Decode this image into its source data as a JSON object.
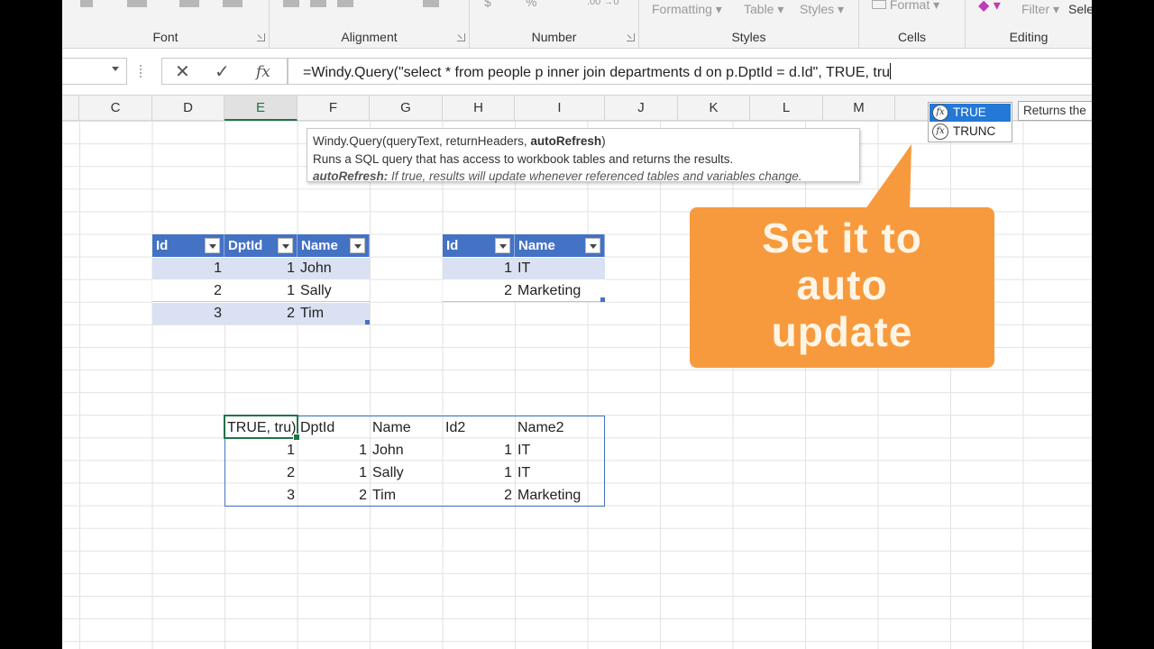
{
  "ribbon": {
    "groups": [
      {
        "label": "Font"
      },
      {
        "label": "Alignment"
      },
      {
        "label": "Number"
      },
      {
        "label": "Styles"
      },
      {
        "label": "Cells"
      },
      {
        "label": "Editing"
      }
    ],
    "styles_items": [
      "Formatting",
      "Table",
      "Styles"
    ],
    "cells_item": "Format",
    "editing_items": [
      "Filter",
      "Sele"
    ],
    "number_items": [
      "$",
      "%",
      ".00 →0"
    ]
  },
  "formula_bar": {
    "name_box": "",
    "cancel_glyph": "✕",
    "enter_glyph": "✓",
    "fx_glyph": "fx",
    "formula": "=Windy.Query(\"select * from people p inner join departments d on p.DptId = d.Id\", TRUE, tru"
  },
  "columns": [
    "C",
    "D",
    "E",
    "F",
    "G",
    "H",
    "I",
    "J",
    "K",
    "L",
    "M"
  ],
  "selected_column": "E",
  "tooltip": {
    "signature_prefix": "Windy.Query(queryText, returnHeaders, ",
    "signature_bold": "autoRefresh",
    "signature_suffix": ")",
    "description": "Runs a SQL query that has access to workbook tables and returns the results.",
    "param_name": "autoRefresh:",
    "param_desc": " If true, results will update whenever referenced tables and variables change."
  },
  "autocomplete": {
    "items": [
      "TRUE",
      "TRUNC"
    ],
    "icon_glyph": "fx",
    "hint": "Returns the"
  },
  "callout": {
    "text_line1": "Set it to",
    "text_line2": "auto",
    "text_line3": "update"
  },
  "people_table": {
    "headers": [
      "Id",
      "DptId",
      "Name"
    ],
    "rows": [
      [
        "1",
        "1",
        "John"
      ],
      [
        "2",
        "1",
        "Sally"
      ],
      [
        "3",
        "2",
        "Tim"
      ]
    ]
  },
  "departments_table": {
    "headers": [
      "Id",
      "Name"
    ],
    "rows": [
      [
        "1",
        "IT"
      ],
      [
        "2",
        "Marketing"
      ]
    ]
  },
  "result_table": {
    "headers": [
      "TRUE, tru)",
      "DptId",
      "Name",
      "Id2",
      "Name2"
    ],
    "rows": [
      [
        "1",
        "1",
        "John",
        "1",
        "IT"
      ],
      [
        "2",
        "1",
        "Sally",
        "1",
        "IT"
      ],
      [
        "3",
        "2",
        "Tim",
        "2",
        "Marketing"
      ]
    ]
  }
}
